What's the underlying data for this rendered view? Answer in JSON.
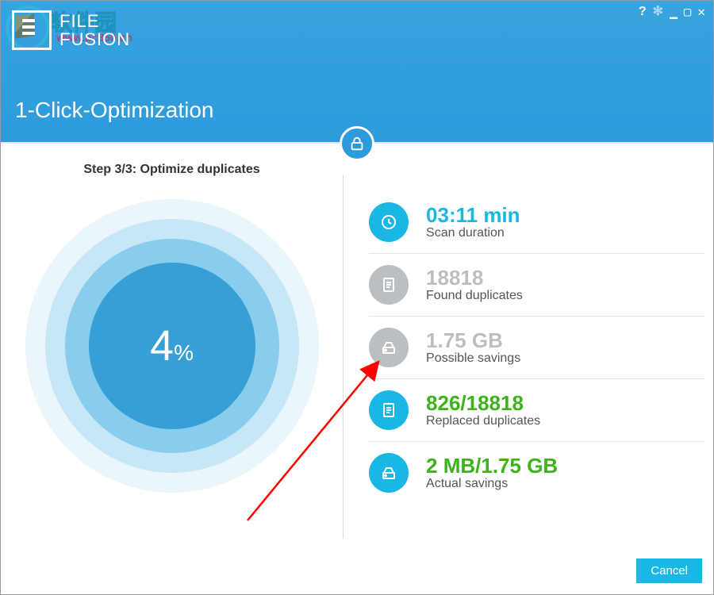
{
  "app": {
    "name_line1": "FILE",
    "name_line2": "FUSION"
  },
  "watermark": {
    "text": "软件园",
    "sub": "www.pc350.cn"
  },
  "header": {
    "page_title": "1-Click-Optimization"
  },
  "progress": {
    "step_label": "Step 3/3: Optimize duplicates",
    "percent": "4",
    "percent_sign": "%"
  },
  "stats": {
    "duration": {
      "value": "03:11 min",
      "label": "Scan duration"
    },
    "found": {
      "value": "18818",
      "label": "Found duplicates"
    },
    "possible": {
      "value": "1.75 GB",
      "label": "Possible savings"
    },
    "replaced": {
      "value": "826/18818",
      "label": "Replaced duplicates"
    },
    "actual": {
      "value": "2 MB/1.75 GB",
      "label": "Actual savings"
    }
  },
  "footer": {
    "cancel_label": "Cancel"
  }
}
